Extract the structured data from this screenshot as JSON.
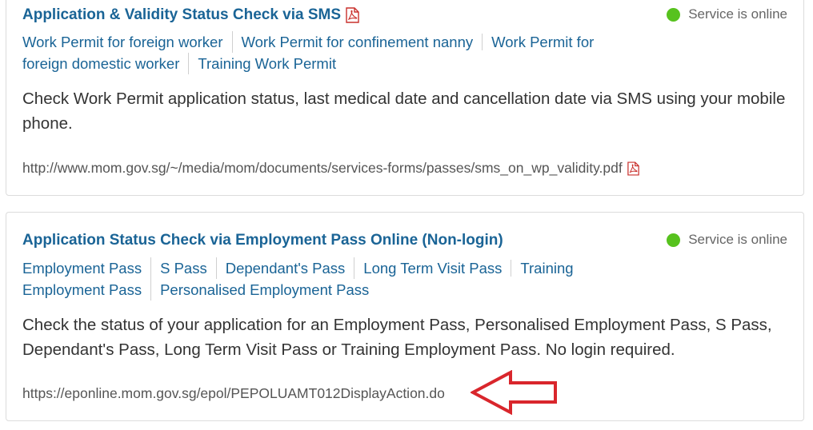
{
  "cards": [
    {
      "title": "Application & Validity Status Check via SMS",
      "title_icon": "pdf-icon",
      "status": "Service is online",
      "status_color": "#57c21e",
      "tags": [
        "Work Permit for foreign worker",
        "Work Permit for confinement nanny",
        "Work Permit for foreign domestic worker",
        "Training Work Permit"
      ],
      "description": "Check Work Permit application status, last medical date and cancellation date via SMS using your mobile phone.",
      "url": "http://www.mom.gov.sg/~/media/mom/documents/services-forms/passes/sms_on_wp_validity.pdf",
      "url_icon": "pdf-icon"
    },
    {
      "title": "Application Status Check via Employment Pass Online (Non-login)",
      "status": "Service is online",
      "status_color": "#57c21e",
      "tags": [
        "Employment Pass",
        "S Pass",
        "Dependant's Pass",
        "Long Term Visit Pass",
        "Training Employment Pass",
        "Personalised Employment Pass"
      ],
      "description": "Check the status of your application for an Employment Pass, Personalised Employment Pass, S Pass, Dependant's Pass, Long Term Visit Pass or Training Employment Pass. No login required.",
      "url": "https://eponline.mom.gov.sg/epol/PEPOLUAMT012DisplayAction.do"
    }
  ],
  "annotation": {
    "type": "arrow",
    "color": "#d9262c"
  }
}
